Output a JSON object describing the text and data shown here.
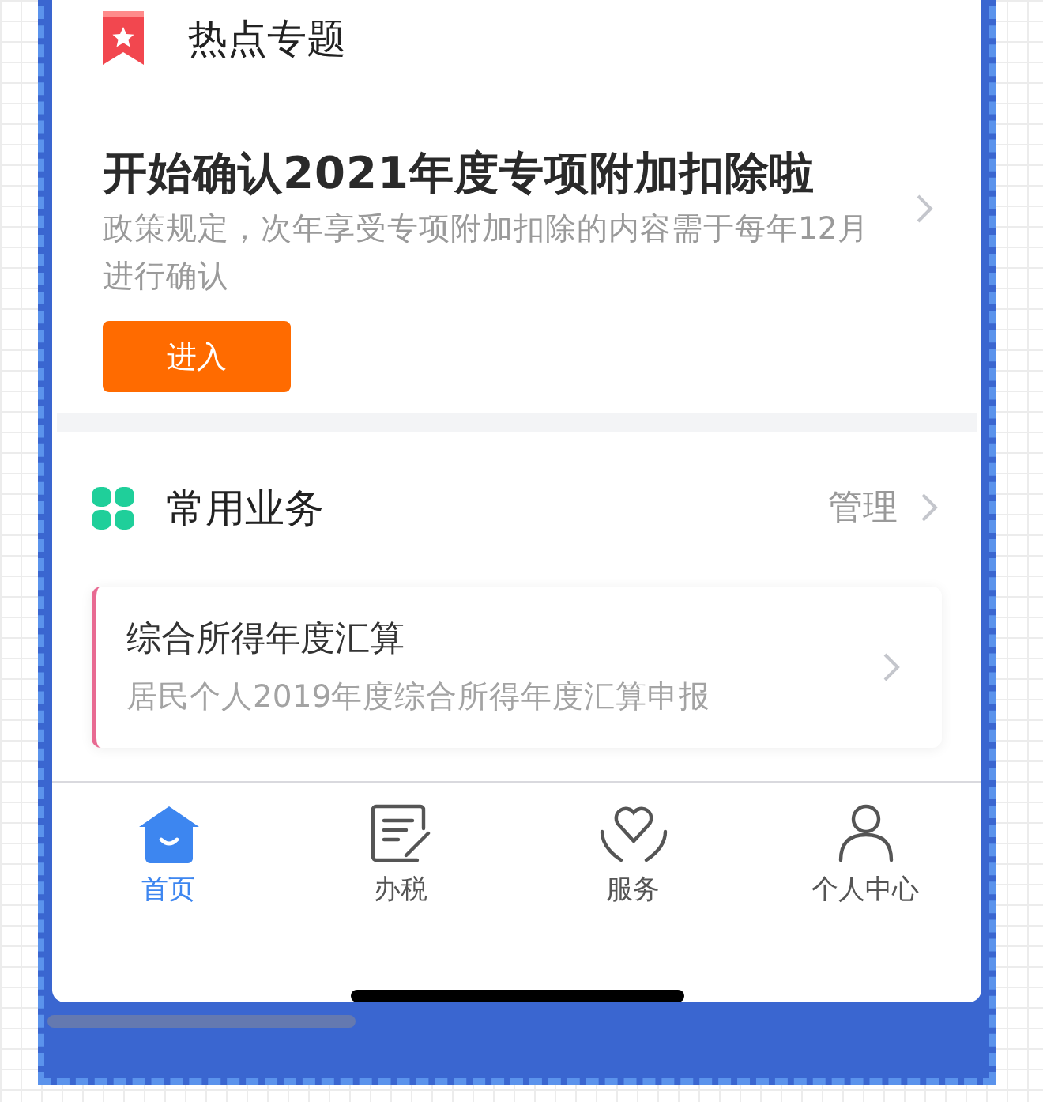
{
  "hot_topic": {
    "title": "热点专题",
    "headline": "开始确认2021年度专项附加扣除啦",
    "description": "政策规定，次年享受专项附加扣除的内容需于每年12月进行确认",
    "button": "进入"
  },
  "common_services": {
    "title": "常用业务",
    "manage_link": "管理",
    "items": [
      {
        "title": "综合所得年度汇算",
        "subtitle": "居民个人2019年度综合所得年度汇算申报"
      }
    ]
  },
  "tab_bar": [
    {
      "kind": "home",
      "label": "首页",
      "selected": true
    },
    {
      "kind": "tax",
      "label": "办税",
      "selected": false
    },
    {
      "kind": "service",
      "label": "服务",
      "selected": false
    },
    {
      "kind": "profile",
      "label": "个人中心",
      "selected": false
    }
  ]
}
